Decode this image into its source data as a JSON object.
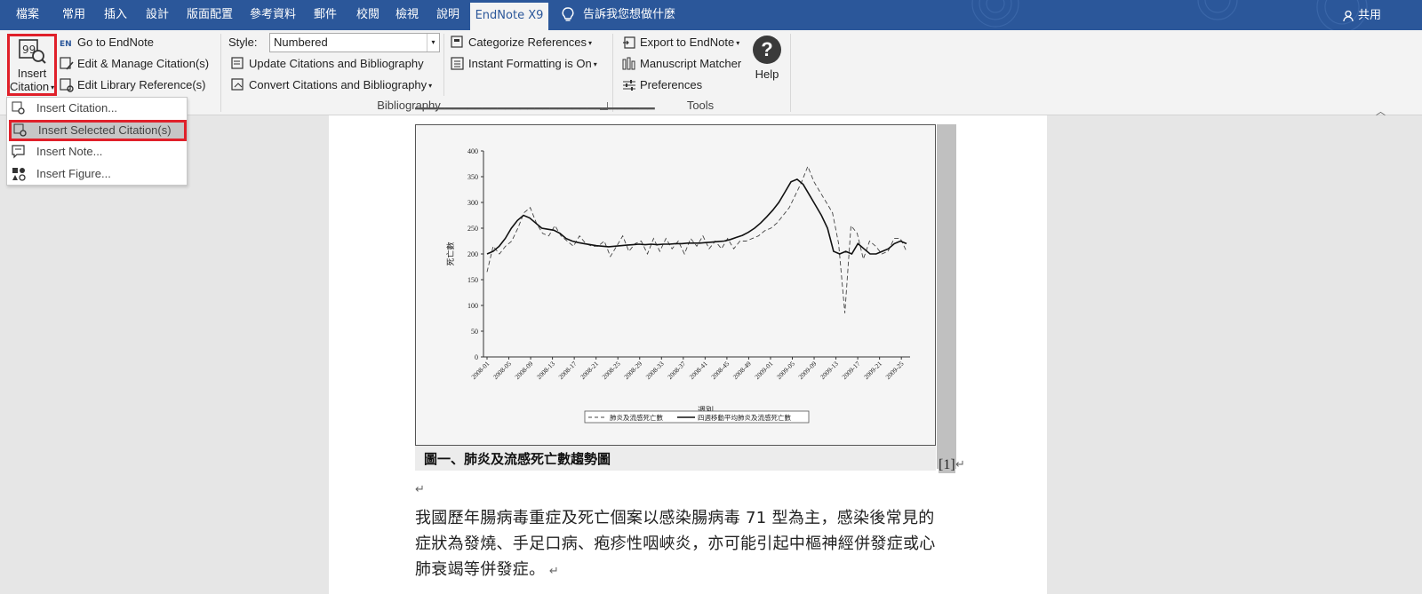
{
  "tabs": [
    {
      "label": "檔案"
    },
    {
      "label": "常用"
    },
    {
      "label": "插入"
    },
    {
      "label": "設計"
    },
    {
      "label": "版面配置"
    },
    {
      "label": "參考資料"
    },
    {
      "label": "郵件"
    },
    {
      "label": "校閱"
    },
    {
      "label": "檢視"
    },
    {
      "label": "說明"
    },
    {
      "label": "EndNote X9"
    }
  ],
  "tell_me": "告訴我您想做什麼",
  "share": "共用",
  "ribbon": {
    "insert_citation": {
      "line1": "Insert",
      "line2": "Citation"
    },
    "go_to_endnote": "Go to EndNote",
    "edit_manage": "Edit & Manage Citation(s)",
    "edit_library": "Edit Library Reference(s)",
    "style_label": "Style:",
    "style_value": "Numbered",
    "update_citations": "Update Citations and Bibliography",
    "convert_citations": "Convert Citations and Bibliography",
    "categorize": "Categorize References",
    "instant_formatting": "Instant Formatting is On",
    "bibliography_group": "Bibliography",
    "export": "Export to EndNote",
    "manuscript": "Manuscript Matcher",
    "preferences": "Preferences",
    "help": "Help",
    "tools_group": "Tools"
  },
  "menu": {
    "items": [
      {
        "label": "Insert Citation..."
      },
      {
        "label": "Insert Selected Citation(s)"
      },
      {
        "label": "Insert Note..."
      },
      {
        "label": "Insert Figure..."
      }
    ]
  },
  "document": {
    "figure_caption": "圖一、肺炎及流感死亡數趨勢圖",
    "citation": "[1]",
    "paragraph_lines": [
      "我國歷年腸病毒重症及死亡個案以感染腸病毒 71 型為主，感染後常見的",
      "症狀為發燒、手足口病、疱疹性咽峽炎，亦可能引起中樞神經併發症或心",
      "肺衰竭等併發症。"
    ]
  },
  "chart_data": {
    "type": "line",
    "ylabel": "死亡數",
    "xlabel": "週別",
    "ylim": [
      0,
      400
    ],
    "yticks": [
      0,
      50,
      100,
      150,
      200,
      250,
      300,
      350,
      400
    ],
    "xticks": [
      "2008-01",
      "2008-05",
      "2008-09",
      "2008-13",
      "2008-17",
      "2008-21",
      "2008-25",
      "2008-29",
      "2008-33",
      "2008-37",
      "2008-41",
      "2008-45",
      "2008-49",
      "2009-01",
      "2009-05",
      "2009-09",
      "2009-13",
      "2009-17",
      "2009-21",
      "2009-25"
    ],
    "series": [
      {
        "name": "肺炎及流感死亡數",
        "style": "dashed",
        "values": [
          165,
          215,
          200,
          215,
          225,
          250,
          280,
          290,
          260,
          240,
          235,
          255,
          235,
          225,
          215,
          235,
          220,
          215,
          215,
          225,
          195,
          215,
          235,
          205,
          220,
          225,
          200,
          230,
          205,
          230,
          210,
          225,
          200,
          230,
          215,
          235,
          210,
          225,
          210,
          230,
          210,
          225,
          225,
          230,
          235,
          245,
          250,
          260,
          275,
          290,
          315,
          340,
          370,
          340,
          320,
          300,
          280,
          220,
          85,
          255,
          240,
          190,
          225,
          215,
          200,
          205,
          230,
          230,
          205
        ]
      },
      {
        "name": "四週移動平均肺炎及流感死亡數",
        "style": "solid",
        "values": [
          200,
          205,
          215,
          230,
          250,
          265,
          275,
          270,
          260,
          250,
          248,
          246,
          240,
          230,
          225,
          222,
          220,
          218,
          216,
          215,
          214,
          215,
          216,
          217,
          218,
          219,
          218,
          219,
          218,
          219,
          219,
          220,
          220,
          221,
          221,
          221,
          222,
          223,
          224,
          225,
          228,
          232,
          236,
          242,
          250,
          260,
          272,
          285,
          300,
          320,
          340,
          345,
          335,
          315,
          295,
          275,
          250,
          205,
          200,
          205,
          200,
          220,
          210,
          200,
          200,
          205,
          210,
          220,
          225,
          220
        ]
      }
    ]
  }
}
